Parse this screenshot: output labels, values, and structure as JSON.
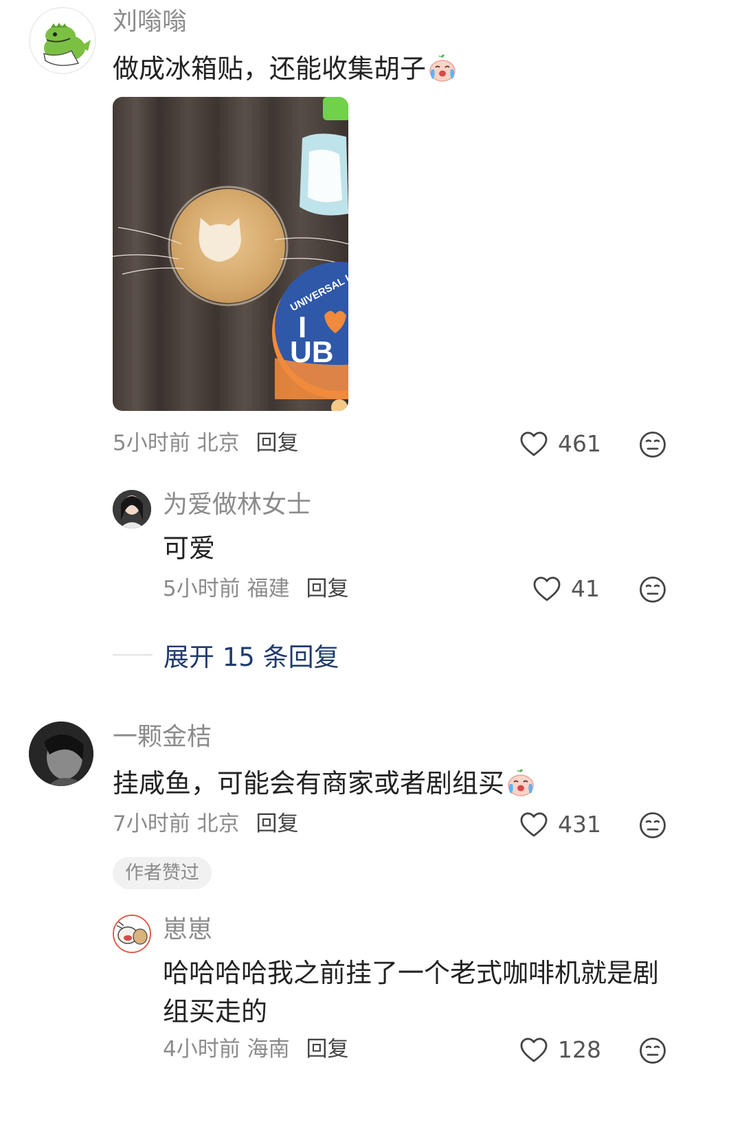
{
  "comments": [
    {
      "username": "刘嗡嗡",
      "text": "做成冰箱贴，还能收集胡子",
      "time": "5小时前",
      "location": "北京",
      "reply_label": "回复",
      "likes": "461",
      "has_image": true,
      "replies": [
        {
          "username": "为爱做林女士",
          "text": "可爱",
          "time": "5小时前",
          "location": "福建",
          "reply_label": "回复",
          "likes": "41"
        }
      ],
      "expand_label": "展开 15 条回复"
    },
    {
      "username": "一颗金桔",
      "text": "挂咸鱼，可能会有商家或者剧组买",
      "time": "7小时前",
      "location": "北京",
      "reply_label": "回复",
      "likes": "431",
      "badge": "作者赞过",
      "replies": [
        {
          "username": "崽崽",
          "text": "哈哈哈哈我之前挂了一个老式咖啡机就是剧组买走的",
          "time": "4小时前",
          "location": "海南",
          "reply_label": "回复",
          "likes": "128"
        }
      ]
    }
  ],
  "photo": {
    "magnet_text_1": "UNIVERSAL LOVE",
    "magnet_text_2": "I",
    "magnet_text_3": "UB"
  },
  "icons": {
    "like": "heart-outline-icon",
    "dislike": "neutral-face-icon",
    "emoji": "crying-face-emoji"
  },
  "colors": {
    "name": "#8b8b8b",
    "link": "#1f3b6c",
    "text": "#222222",
    "badge_bg": "#f1f1f1"
  }
}
